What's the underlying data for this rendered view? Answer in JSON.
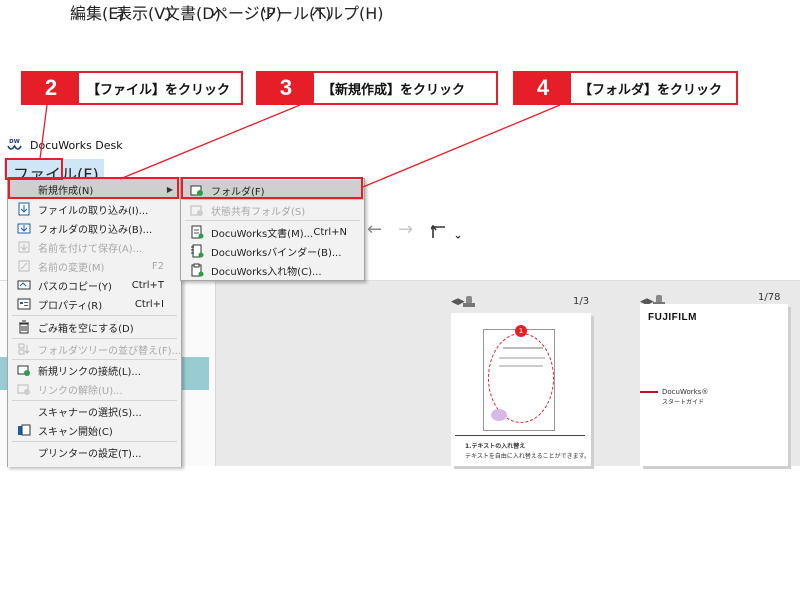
{
  "steps": [
    {
      "number": "2",
      "text": "【ファイル】をクリック"
    },
    {
      "number": "3",
      "text": "【新規作成】をクリック"
    },
    {
      "number": "4",
      "text": "【フォルダ】をクリック"
    }
  ],
  "window": {
    "title": "DocuWorks Desk",
    "logo_text": "DW"
  },
  "menubar": [
    {
      "label": "ファイル(F)"
    },
    {
      "label": "編集(E)"
    },
    {
      "label": "表示(V)"
    },
    {
      "label": "文書(D)"
    },
    {
      "label": "ページ(P)"
    },
    {
      "label": "ツール(T)"
    },
    {
      "label": "ヘルプ(H)"
    }
  ],
  "file_menu": [
    {
      "label": "新規作成(N)",
      "shortcut": "",
      "enabled": true,
      "icon": "",
      "submenu": true
    },
    {
      "label": "ファイルの取り込み(I)...",
      "shortcut": "",
      "enabled": true,
      "icon": "import-file-icon"
    },
    {
      "label": "フォルダの取り込み(B)...",
      "shortcut": "",
      "enabled": true,
      "icon": "import-folder-icon"
    },
    {
      "label": "名前を付けて保存(A)...",
      "shortcut": "",
      "enabled": false,
      "icon": "save-as-icon"
    },
    {
      "label": "名前の変更(M)",
      "shortcut": "F2",
      "enabled": false,
      "icon": "rename-icon"
    },
    {
      "label": "パスのコピー(Y)",
      "shortcut": "Ctrl+T",
      "enabled": true,
      "icon": "copy-path-icon"
    },
    {
      "label": "プロパティ(R)",
      "shortcut": "Ctrl+I",
      "enabled": true,
      "icon": "properties-icon"
    },
    {
      "label": "ごみ箱を空にする(D)",
      "shortcut": "",
      "enabled": true,
      "icon": "trash-icon"
    },
    {
      "label": "フォルダツリーの並び替え(F)...",
      "shortcut": "",
      "enabled": false,
      "icon": "sort-tree-icon"
    },
    {
      "label": "新規リンクの接続(L)...",
      "shortcut": "",
      "enabled": true,
      "icon": "new-link-icon"
    },
    {
      "label": "リンクの解除(U)...",
      "shortcut": "",
      "enabled": false,
      "icon": "unlink-icon"
    },
    {
      "label": "スキャナーの選択(S)...",
      "shortcut": "",
      "enabled": true,
      "icon": ""
    },
    {
      "label": "スキャン開始(C)",
      "shortcut": "",
      "enabled": true,
      "icon": "scan-icon"
    },
    {
      "label": "プリンターの設定(T)...",
      "shortcut": "",
      "enabled": true,
      "icon": ""
    }
  ],
  "new_submenu": [
    {
      "label": "フォルダ(F)",
      "shortcut": "",
      "enabled": true,
      "icon": "folder-icon"
    },
    {
      "label": "状態共有フォルダ(S)",
      "shortcut": "",
      "enabled": false,
      "icon": "shared-folder-icon"
    },
    {
      "label": "DocuWorks文書(M)...",
      "shortcut": "Ctrl+N",
      "enabled": true,
      "icon": "document-icon"
    },
    {
      "label": "DocuWorksバインダー(B)...",
      "shortcut": "",
      "enabled": true,
      "icon": "binder-icon"
    },
    {
      "label": "DocuWorks入れ物(C)...",
      "shortcut": "",
      "enabled": true,
      "icon": "container-icon"
    }
  ],
  "documents": [
    {
      "pages": "1/3",
      "heading": "1.テキストの入れ替え",
      "body": "テキストを自由に入れ替えることができます。",
      "badge": "1"
    },
    {
      "pages": "1/78",
      "brand": "FUJIFILM",
      "line1": "DocuWorks®",
      "line2": "スタートガイド"
    }
  ],
  "colors": {
    "accent": "#e61e28",
    "menu_bg": "#f2f2f2",
    "selection": "#99cbd3"
  }
}
